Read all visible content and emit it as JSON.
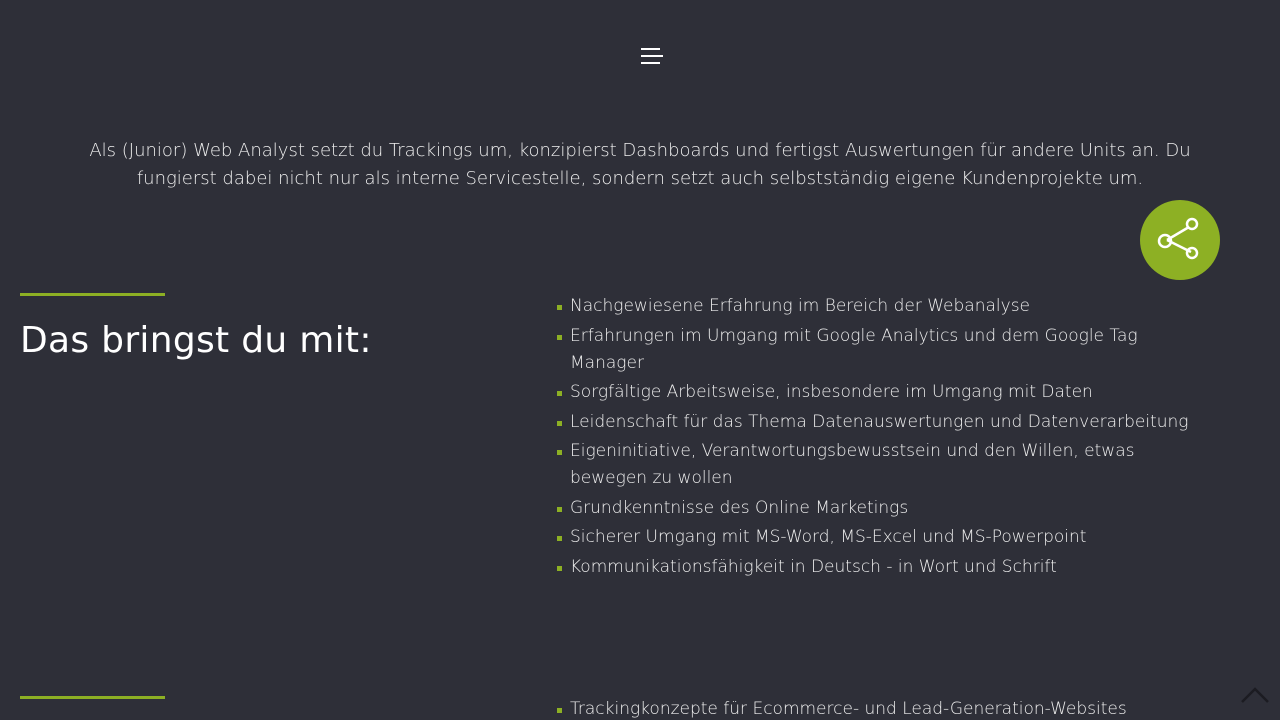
{
  "header": {
    "menu_icon": "hamburger-menu-icon"
  },
  "intro": {
    "text": "Als (Junior) Web Analyst setzt du Trackings um, konzipierst Dashboards und fertigst Auswertungen für andere Units an. Du fungierst dabei nicht nur als interne Servicestelle, sondern setzt auch selbstständig eigene Kundenprojekte um."
  },
  "share": {
    "icon": "share-icon",
    "color": "#8db024"
  },
  "requirements": {
    "heading": "Das bringst du mit:",
    "items": [
      "Nachgewiesene Erfahrung im Bereich der Webanalyse",
      "Erfahrungen im Umgang mit Google Analytics und dem Google Tag Manager",
      "Sorgfältige Arbeitsweise, insbesondere im Umgang mit Daten",
      "Leidenschaft für das Thema Datenauswertungen und Datenverarbeitung",
      "Eigeninitiative, Verantwortungsbewusstsein und den Willen, etwas bewegen zu wollen",
      "Grundkenntnisse des Online Marketings",
      "Sicherer Umgang mit MS-Word, MS-Excel und MS-Powerpoint",
      "Kommunikationsfähigkeit in Deutsch - in Wort und Schrift"
    ]
  },
  "tasks": {
    "items": [
      "Trackingkonzepte für Ecommerce- und Lead-Generation-Websites"
    ]
  },
  "scroll_top": {
    "icon": "chevron-up-icon"
  },
  "colors": {
    "background": "#2e2f38",
    "accent": "#8db024",
    "text": "#eeeeee"
  }
}
